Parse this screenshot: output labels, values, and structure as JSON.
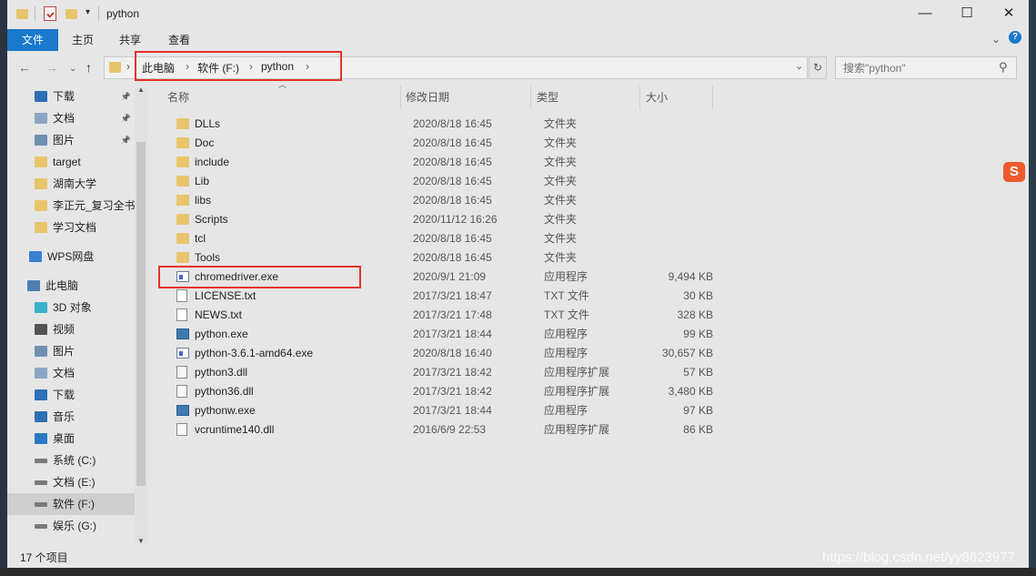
{
  "window": {
    "title": "python",
    "controls": {
      "minimize": "—",
      "maximize": "☐",
      "close": "✕"
    }
  },
  "ribbon": {
    "tabs": [
      "文件",
      "主页",
      "共享",
      "查看"
    ],
    "collapse": "⌄",
    "help": "?"
  },
  "nav": {
    "back": "←",
    "forward": "→",
    "recent": "⌄",
    "up": "↑",
    "breadcrumbs": [
      "此电脑",
      "软件 (F:)",
      "python"
    ],
    "separator": "›",
    "refresh": "↻",
    "search_placeholder": "搜索\"python\"",
    "search_icon": "⚲"
  },
  "sidebar": {
    "items": [
      {
        "label": "下载",
        "icon": "download-icon",
        "pinned": true
      },
      {
        "label": "文档",
        "icon": "document-icon",
        "pinned": true
      },
      {
        "label": "图片",
        "icon": "picture-icon",
        "pinned": true
      },
      {
        "label": "target",
        "icon": "folder-icon"
      },
      {
        "label": "湖南大学",
        "icon": "folder-icon"
      },
      {
        "label": "李正元_复习全书",
        "icon": "folder-icon"
      },
      {
        "label": "学习文档",
        "icon": "folder-icon"
      },
      {
        "label": "WPS网盘",
        "icon": "cloud-icon"
      },
      {
        "label": "此电脑",
        "icon": "computer-icon"
      },
      {
        "label": "3D 对象",
        "icon": "cube-icon"
      },
      {
        "label": "视频",
        "icon": "video-icon"
      },
      {
        "label": "图片",
        "icon": "picture-icon"
      },
      {
        "label": "文档",
        "icon": "document-icon"
      },
      {
        "label": "下载",
        "icon": "download-icon"
      },
      {
        "label": "音乐",
        "icon": "music-icon"
      },
      {
        "label": "桌面",
        "icon": "desktop-icon"
      },
      {
        "label": "系统 (C:)",
        "icon": "drive-icon"
      },
      {
        "label": "文档 (E:)",
        "icon": "drive-icon"
      },
      {
        "label": "软件 (F:)",
        "icon": "drive-icon",
        "selected": true
      },
      {
        "label": "娱乐 (G:)",
        "icon": "drive-icon"
      }
    ]
  },
  "columns": {
    "name": "名称",
    "date": "修改日期",
    "type": "类型",
    "size": "大小"
  },
  "files": [
    {
      "name": "DLLs",
      "date": "2020/8/18 16:45",
      "type": "文件夹",
      "size": "",
      "icon": "folder"
    },
    {
      "name": "Doc",
      "date": "2020/8/18 16:45",
      "type": "文件夹",
      "size": "",
      "icon": "folder"
    },
    {
      "name": "include",
      "date": "2020/8/18 16:45",
      "type": "文件夹",
      "size": "",
      "icon": "folder"
    },
    {
      "name": "Lib",
      "date": "2020/8/18 16:45",
      "type": "文件夹",
      "size": "",
      "icon": "folder"
    },
    {
      "name": "libs",
      "date": "2020/8/18 16:45",
      "type": "文件夹",
      "size": "",
      "icon": "folder"
    },
    {
      "name": "Scripts",
      "date": "2020/11/12 16:26",
      "type": "文件夹",
      "size": "",
      "icon": "folder"
    },
    {
      "name": "tcl",
      "date": "2020/8/18 16:45",
      "type": "文件夹",
      "size": "",
      "icon": "folder"
    },
    {
      "name": "Tools",
      "date": "2020/8/18 16:45",
      "type": "文件夹",
      "size": "",
      "icon": "folder"
    },
    {
      "name": "chromedriver.exe",
      "date": "2020/9/1 21:09",
      "type": "应用程序",
      "size": "9,494 KB",
      "icon": "exe"
    },
    {
      "name": "LICENSE.txt",
      "date": "2017/3/21 18:47",
      "type": "TXT 文件",
      "size": "30 KB",
      "icon": "txt"
    },
    {
      "name": "NEWS.txt",
      "date": "2017/3/21 17:48",
      "type": "TXT 文件",
      "size": "328 KB",
      "icon": "txt"
    },
    {
      "name": "python.exe",
      "date": "2017/3/21 18:44",
      "type": "应用程序",
      "size": "99 KB",
      "icon": "py"
    },
    {
      "name": "python-3.6.1-amd64.exe",
      "date": "2020/8/18 16:40",
      "type": "应用程序",
      "size": "30,657 KB",
      "icon": "exe"
    },
    {
      "name": "python3.dll",
      "date": "2017/3/21 18:42",
      "type": "应用程序扩展",
      "size": "57 KB",
      "icon": "dll"
    },
    {
      "name": "python36.dll",
      "date": "2017/3/21 18:42",
      "type": "应用程序扩展",
      "size": "3,480 KB",
      "icon": "dll"
    },
    {
      "name": "pythonw.exe",
      "date": "2017/3/21 18:44",
      "type": "应用程序",
      "size": "97 KB",
      "icon": "py"
    },
    {
      "name": "vcruntime140.dll",
      "date": "2016/6/9 22:53",
      "type": "应用程序扩展",
      "size": "86 KB",
      "icon": "dll"
    }
  ],
  "status": {
    "count": "17 个项目"
  },
  "overlay": {
    "sogou": "S",
    "watermark": "https://blog.csdn.net/yy8623977"
  },
  "colors": {
    "accent": "#1979ca",
    "highlight": "#e4322b",
    "folder": "#e8c56d"
  }
}
